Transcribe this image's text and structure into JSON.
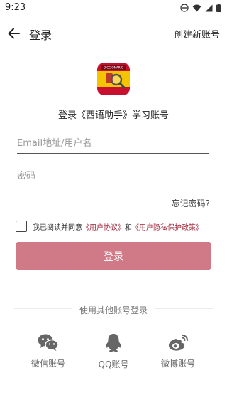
{
  "status_bar": {
    "time": "9:23",
    "icons": [
      "do-not-disturb-icon",
      "wifi-icon",
      "signal-icon",
      "battery-icon"
    ]
  },
  "header": {
    "title": "登录",
    "create_account": "创建新账号",
    "back_icon": "arrow-left-icon"
  },
  "logo": {
    "text": "DICCIONARIO",
    "colors": {
      "red": "#c8102e",
      "yellow": "#f4c400"
    }
  },
  "subtitle": "登录《西语助手》学习账号",
  "form": {
    "email_placeholder": "Email地址/用户名",
    "password_placeholder": "密码",
    "forgot_password": "忘记密码?"
  },
  "agreement": {
    "checked": false,
    "prefix": "我已阅读并同意",
    "user_agreement": "《用户协议》",
    "and": "和",
    "privacy_policy": "《用户隐私保护政策》"
  },
  "login_button": "登录",
  "other_login": {
    "label": "使用其他账号登录",
    "options": [
      {
        "label": "微信账号",
        "icon": "wechat-icon"
      },
      {
        "label": "QQ账号",
        "icon": "qq-icon"
      },
      {
        "label": "微博账号",
        "icon": "weibo-icon"
      }
    ]
  },
  "colors": {
    "accent": "#cf7a86",
    "link": "#a0293d",
    "social_icon": "#666666"
  }
}
